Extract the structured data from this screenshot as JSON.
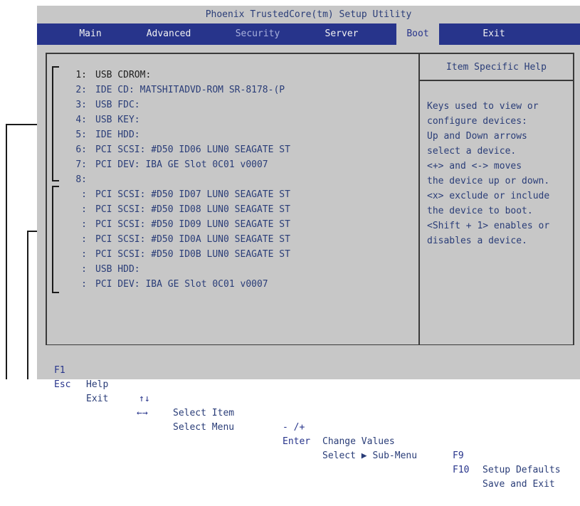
{
  "title": "Phoenix TrustedCore(tm) Setup Utility",
  "menu": [
    "Main",
    "Advanced",
    "Security",
    "Server",
    "Boot",
    "Exit"
  ],
  "active_menu": "Boot",
  "boot_items": [
    {
      "num": "1:",
      "label": "USB CDROM:"
    },
    {
      "num": "2:",
      "label": "IDE CD: MATSHITADVD-ROM SR-8178-(P"
    },
    {
      "num": "3:",
      "label": "USB FDC:"
    },
    {
      "num": "4:",
      "label": "USB KEY:"
    },
    {
      "num": "5:",
      "label": "IDE HDD:"
    },
    {
      "num": "6:",
      "label": "PCI SCSI: #D50 ID06 LUN0 SEAGATE ST"
    },
    {
      "num": "7:",
      "label": "PCI DEV: IBA GE Slot 0C01 v0007"
    },
    {
      "num": "8:",
      "label": ""
    },
    {
      "num": ":",
      "label": "PCI SCSI: #D50 ID07 LUN0 SEAGATE ST"
    },
    {
      "num": ":",
      "label": "PCI SCSI: #D50 ID08 LUN0 SEAGATE ST"
    },
    {
      "num": ":",
      "label": "PCI SCSI: #D50 ID09 LUN0 SEAGATE ST"
    },
    {
      "num": ":",
      "label": "PCI SCSI: #D50 ID0A LUN0 SEAGATE ST"
    },
    {
      "num": ":",
      "label": "PCI SCSI: #D50 ID0B LUN0 SEAGATE ST"
    },
    {
      "num": ":",
      "label": "USB HDD:"
    },
    {
      "num": ":",
      "label": "PCI DEV: IBA GE Slot 0C01 v0007"
    }
  ],
  "help": {
    "title": "Item Specific Help",
    "text": "Keys used to view or\nconfigure devices:\nUp and Down arrows\nselect a device.\n<+> and <-> moves\nthe device up or down.\n<x> exclude or include\nthe device to boot.\n<Shift + 1> enables or\ndisables a device."
  },
  "footer": {
    "row1": [
      {
        "key": "F1",
        "label": "Help"
      },
      {
        "key": "↑↓",
        "label": "Select Item"
      },
      {
        "key": "- /+",
        "label": "Change Values"
      },
      {
        "key": "F9",
        "label": "Setup Defaults"
      }
    ],
    "row2": [
      {
        "key": "Esc",
        "label": "Exit"
      },
      {
        "key": "←→",
        "label": "Select Menu"
      },
      {
        "key": "Enter",
        "label": "Select ▶ Sub-Menu"
      },
      {
        "key": "F10",
        "label": "Save and Exit"
      }
    ]
  },
  "colors": {
    "menubar": "#27348b",
    "background": "#c7c7c7",
    "text": "#2a3d78"
  }
}
